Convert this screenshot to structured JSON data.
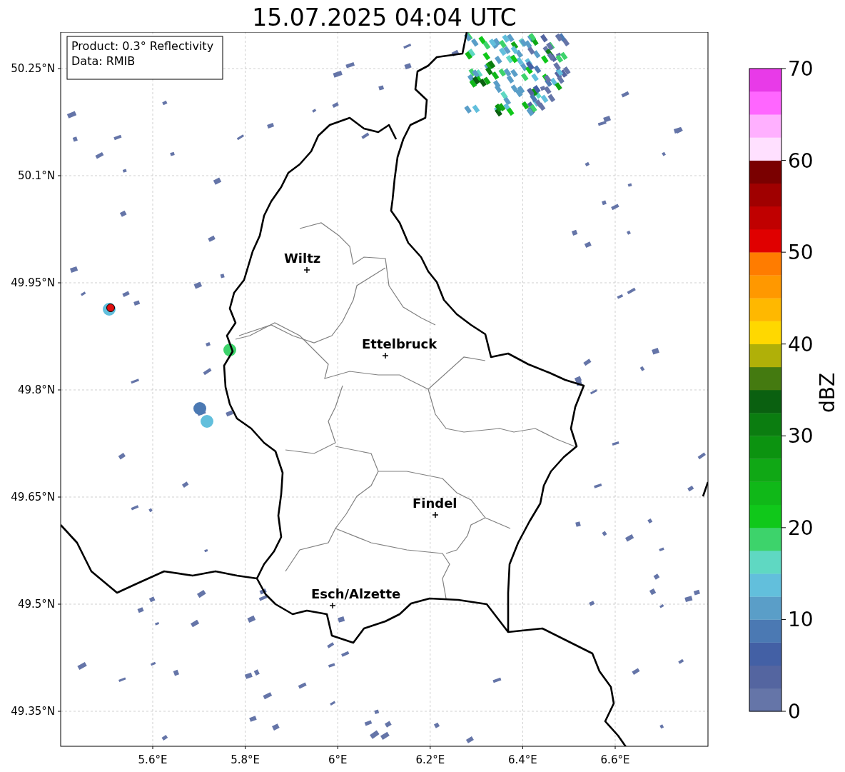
{
  "title": "15.07.2025 04:04 UTC",
  "info_box": {
    "lines": [
      "Product: 0.3° Reflectivity",
      "Data: RMIB"
    ]
  },
  "y_ticks": [
    "50.25°N",
    "50.1°N",
    "49.95°N",
    "49.8°N",
    "49.65°N",
    "49.5°N",
    "49.35°N"
  ],
  "x_ticks": [
    "5.6°E",
    "5.8°E",
    "6°E",
    "6.2°E",
    "6.4°E",
    "6.6°E"
  ],
  "cities": [
    {
      "name": "Wiltz"
    },
    {
      "name": "Ettelbruck"
    },
    {
      "name": "Findel"
    },
    {
      "name": "Esch/Alzette"
    }
  ],
  "radar_site": {
    "color": "#e01010"
  },
  "colorbar": {
    "label": "dBZ",
    "ticks": [
      "70",
      "60",
      "50",
      "40",
      "30",
      "20",
      "10",
      "0"
    ],
    "segments": [
      {
        "color": "#6575a8"
      },
      {
        "color": "#5465a0"
      },
      {
        "color": "#4360a5"
      },
      {
        "color": "#4b79b3"
      },
      {
        "color": "#5a9ec8"
      },
      {
        "color": "#62bfdc"
      },
      {
        "color": "#5fd8c2"
      },
      {
        "color": "#3dd36b"
      },
      {
        "color": "#10c81a"
      },
      {
        "color": "#10b818"
      },
      {
        "color": "#10a815"
      },
      {
        "color": "#0c9310"
      },
      {
        "color": "#0b7d10"
      },
      {
        "color": "#0a6010"
      },
      {
        "color": "#447a10"
      },
      {
        "color": "#b0b008"
      },
      {
        "color": "#ffd800"
      },
      {
        "color": "#ffb800"
      },
      {
        "color": "#ff9800"
      },
      {
        "color": "#ff7c00"
      },
      {
        "color": "#e00000"
      },
      {
        "color": "#c00000"
      },
      {
        "color": "#a00000"
      },
      {
        "color": "#7a0000"
      },
      {
        "color": "#ffe0ff"
      },
      {
        "color": "#ffb0ff"
      },
      {
        "color": "#ff66ff"
      },
      {
        "color": "#e83ae8"
      }
    ]
  }
}
